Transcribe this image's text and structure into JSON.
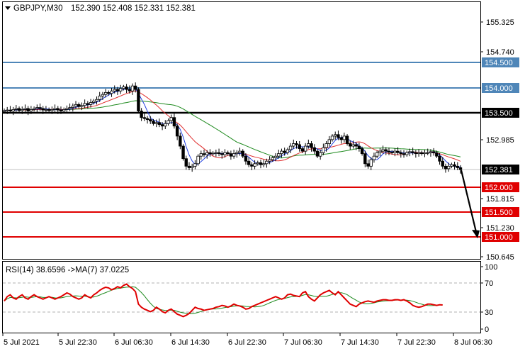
{
  "window": {
    "symbol_label": "GBPJPY,M30",
    "ohlc_text": "152.390 152.408 152.331 152.381"
  },
  "rsi_panel": {
    "label": "RSI(14) 38.6596  ->MA(7) 37.0225"
  },
  "colors": {
    "bull": "#ffffff",
    "bear": "#000000",
    "ma_fast": "#1f3fe0",
    "ma_mid": "#e03030",
    "ma_slow": "#1e8a1e",
    "resistance": "#4f86b8",
    "pivot": "#000000",
    "support": "#e00000",
    "rsi_line": "#e00000",
    "rsi_ma": "#1e8a1e"
  },
  "chart_data": [
    {
      "type": "candlestick",
      "title": "GBPJPY,M30",
      "y_ticks": [
        "155.325",
        "154.740",
        "152.985",
        "151.815",
        "151.230",
        "150.645"
      ],
      "ylim": [
        150.5,
        155.7
      ],
      "level_lines": [
        {
          "label": "154.500",
          "value": 154.5,
          "role": "resistance"
        },
        {
          "label": "154.000",
          "value": 154.0,
          "role": "resistance"
        },
        {
          "label": "153.500",
          "value": 153.5,
          "role": "pivot"
        },
        {
          "label": "152.000",
          "value": 152.0,
          "role": "support"
        },
        {
          "label": "151.500",
          "value": 151.5,
          "role": "support"
        },
        {
          "label": "151.000",
          "value": 151.0,
          "role": "support"
        }
      ],
      "current_price_label": "152.381",
      "current_price": 152.381,
      "close_series": [
        153.56,
        153.57,
        153.55,
        153.58,
        153.6,
        153.56,
        153.58,
        153.6,
        153.55,
        153.58,
        153.6,
        153.62,
        153.6,
        153.57,
        153.58,
        153.56,
        153.58,
        153.6,
        153.57,
        153.55,
        153.58,
        153.6,
        153.62,
        153.65,
        153.68,
        153.64,
        153.66,
        153.7,
        153.68,
        153.72,
        153.75,
        153.78,
        153.85,
        153.88,
        153.92,
        153.9,
        153.95,
        153.98,
        153.95,
        154.0,
        154.03,
        153.98,
        153.95,
        154.05,
        153.98,
        153.55,
        153.42,
        153.4,
        153.38,
        153.35,
        153.3,
        153.32,
        153.28,
        153.25,
        153.3,
        153.36,
        153.42,
        153.25,
        153.05,
        152.85,
        152.6,
        152.45,
        152.42,
        152.45,
        152.5,
        152.65,
        152.7,
        152.68,
        152.72,
        152.7,
        152.71,
        152.72,
        152.7,
        152.68,
        152.72,
        152.7,
        152.65,
        152.7,
        152.72,
        152.75,
        152.65,
        152.55,
        152.48,
        152.45,
        152.5,
        152.52,
        152.48,
        152.5,
        152.55,
        152.58,
        152.62,
        152.65,
        152.7,
        152.75,
        152.72,
        152.78,
        152.85,
        152.9,
        152.88,
        152.8,
        152.75,
        152.85,
        152.9,
        152.82,
        152.75,
        152.65,
        152.72,
        152.82,
        152.9,
        152.98,
        153.05,
        153.08,
        153.02,
        152.98,
        153.05,
        152.9,
        152.85,
        152.88,
        152.85,
        152.8,
        152.7,
        152.5,
        152.45,
        152.58,
        152.65,
        152.72,
        152.75,
        152.78,
        152.75,
        152.73,
        152.72,
        152.75,
        152.72,
        152.7,
        152.68,
        152.72,
        152.74,
        152.72,
        152.7,
        152.72,
        152.7,
        152.72,
        152.72,
        152.74,
        152.72,
        152.65,
        152.55,
        152.45,
        152.4,
        152.45,
        152.48,
        152.45,
        152.42,
        152.381
      ],
      "annotation": "arrow pointing down toward 151.000"
    },
    {
      "type": "line",
      "title": "RSI(14) 38.6596  ->MA(7) 37.0225",
      "y_ticks": [
        "100",
        "70",
        "30",
        "0"
      ],
      "ylim": [
        0,
        100
      ],
      "levels": [
        70,
        30
      ],
      "series": [
        {
          "name": "RSI(14)",
          "last": 38.6596
        },
        {
          "name": "MA(7)",
          "last": 37.0225
        }
      ],
      "rsi_values": [
        45,
        52,
        55,
        50,
        48,
        52,
        55,
        50,
        48,
        52,
        55,
        52,
        50,
        48,
        50,
        52,
        50,
        48,
        50,
        52,
        55,
        58,
        56,
        52,
        50,
        48,
        50,
        55,
        52,
        50,
        55,
        58,
        62,
        65,
        67,
        66,
        63,
        65,
        68,
        66,
        70,
        72,
        68,
        65,
        60,
        40,
        35,
        32,
        30,
        28,
        30,
        35,
        32,
        28,
        26,
        30,
        32,
        28,
        24,
        22,
        20,
        22,
        25,
        30,
        35,
        33,
        32,
        30,
        31,
        32,
        33,
        35,
        36,
        38,
        37,
        35,
        37,
        40,
        38,
        37,
        35,
        32,
        33,
        36,
        38,
        40,
        42,
        44,
        46,
        48,
        50,
        52,
        50,
        48,
        50,
        55,
        56,
        54,
        53,
        52,
        58,
        60,
        52,
        48,
        45,
        50,
        55,
        58,
        60,
        62,
        58,
        55,
        60,
        55,
        50,
        45,
        40,
        38,
        36,
        40,
        42,
        44,
        45,
        44,
        43,
        45,
        46,
        47,
        47,
        46,
        46,
        47,
        47,
        46,
        47,
        45,
        42,
        38,
        36,
        35,
        36,
        38,
        40,
        40,
        39,
        38,
        39,
        38.66
      ]
    }
  ],
  "x_axis": {
    "ticks": [
      "5 Jul 2021",
      "5 Jul 22:30",
      "6 Jul 06:30",
      "6 Jul 14:30",
      "6 Jul 22:30",
      "7 Jul 06:30",
      "7 Jul 14:30",
      "7 Jul 22:30",
      "8 Jul 06:30"
    ]
  }
}
